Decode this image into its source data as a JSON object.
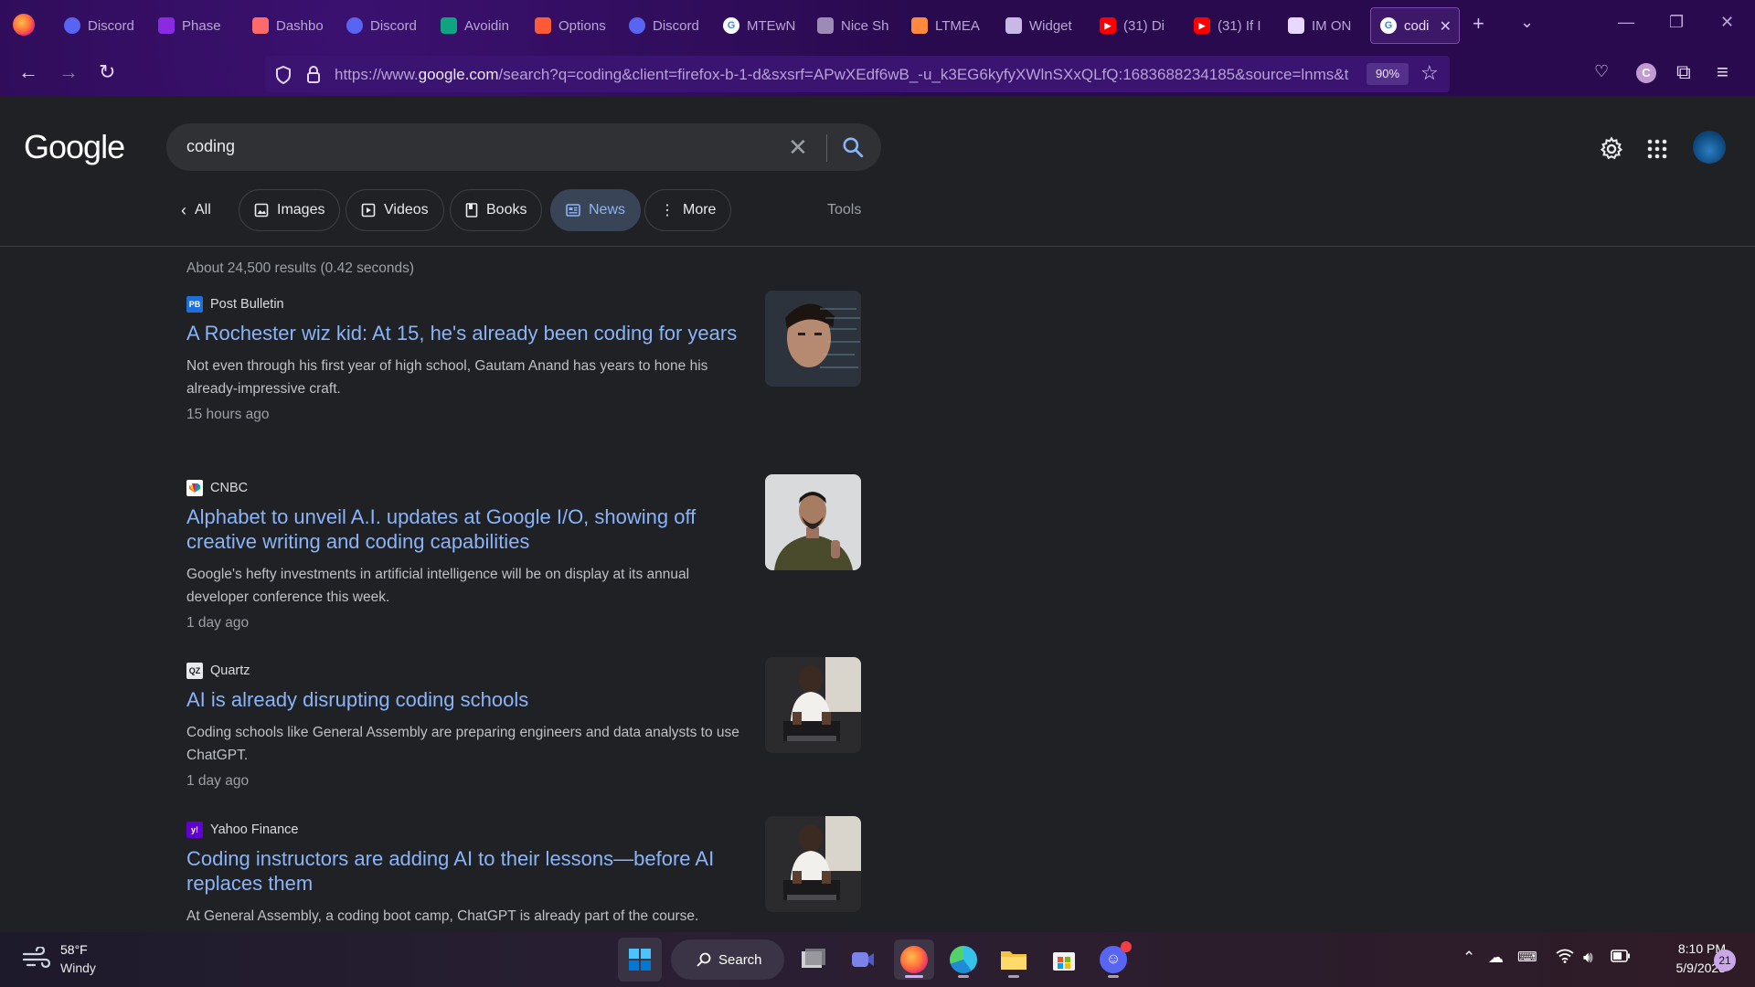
{
  "browser": {
    "tabs": [
      {
        "label": "Discord",
        "icon": "discord-icon",
        "color": "#5865f2"
      },
      {
        "label": "Phase",
        "icon": "phase-icon",
        "color": "#8a2be2"
      },
      {
        "label": "Dashbo",
        "icon": "dashboard-icon",
        "color": "#ff6b6b"
      },
      {
        "label": "Discord",
        "icon": "discord-icon",
        "color": "#5865f2"
      },
      {
        "label": "Avoidin",
        "icon": "openai-icon",
        "color": "#10a37f"
      },
      {
        "label": "Options",
        "icon": "options-icon",
        "color": "#ff5a36"
      },
      {
        "label": "Discord",
        "icon": "discord-icon",
        "color": "#5865f2"
      },
      {
        "label": "MTEwN",
        "icon": "google-icon",
        "color": "#ffffff"
      },
      {
        "label": "Nice Sh",
        "icon": "image-icon",
        "color": "#9b8bb5"
      },
      {
        "label": "LTMEA",
        "icon": "ltmea-icon",
        "color": "#ff8a3d"
      },
      {
        "label": "Widget",
        "icon": "widget-icon",
        "color": "#c8b8e8"
      },
      {
        "label": "(31) Di",
        "icon": "youtube-icon",
        "color": "#ff0000"
      },
      {
        "label": "(31) If I",
        "icon": "youtube-icon",
        "color": "#ff0000"
      },
      {
        "label": "IM ON",
        "icon": "pen-icon",
        "color": "#e8d8ff"
      },
      {
        "label": "codi",
        "icon": "google-icon",
        "color": "#ffffff"
      }
    ],
    "url_prefix": "https://www.",
    "url_domain": "google.com",
    "url_rest": "/search?q=coding&client=firefox-b-1-d&sxsrf=APwXEdf6wB_-u_k3EG6kyfyXWlnSXxQLfQ:1683688234185&source=lnms&t",
    "zoom": "90%"
  },
  "google": {
    "logo": "Google",
    "query": "coding",
    "tabs": [
      {
        "label": "All",
        "icon": "chevron-left-icon"
      },
      {
        "label": "Images",
        "icon": "image-icon"
      },
      {
        "label": "Videos",
        "icon": "play-icon"
      },
      {
        "label": "Books",
        "icon": "book-icon"
      },
      {
        "label": "News",
        "icon": "news-icon"
      },
      {
        "label": "More",
        "icon": "more-vert-icon"
      }
    ],
    "tools": "Tools",
    "stats": "About 24,500 results (0.42 seconds)",
    "results": [
      {
        "source": "Post Bulletin",
        "fav": "PB",
        "fav_color": "#1e6fd9",
        "title": "A Rochester wiz kid: At 15, he's already been coding for years",
        "snippet": "Not even through his first year of high school, Gautam Anand has years to hone his already-impressive craft.",
        "time": "15 hours ago"
      },
      {
        "source": "CNBC",
        "fav": "",
        "fav_color": "#ffffff",
        "title": "Alphabet to unveil A.I. updates at Google I/O, showing off creative writing and coding capabilities",
        "snippet": "Google's hefty investments in artificial intelligence will be on display at its annual developer conference this week.",
        "time": "1 day ago"
      },
      {
        "source": "Quartz",
        "fav": "QZ",
        "fav_color": "#e8eaed",
        "title": "AI is already disrupting coding schools",
        "snippet": "Coding schools like General Assembly are preparing engineers and data analysts to use ChatGPT.",
        "time": "1 day ago"
      },
      {
        "source": "Yahoo Finance",
        "fav": "y!",
        "fav_color": "#6001d2",
        "title": "Coding instructors are adding AI to their lessons—before AI replaces them",
        "snippet": "At General Assembly, a coding boot camp, ChatGPT is already part of the course.",
        "time": ""
      }
    ]
  },
  "taskbar": {
    "weather_temp": "58°F",
    "weather_desc": "Windy",
    "search_label": "Search",
    "clock_time": "8:10 PM",
    "clock_date": "5/9/2023",
    "notifications": "21"
  }
}
